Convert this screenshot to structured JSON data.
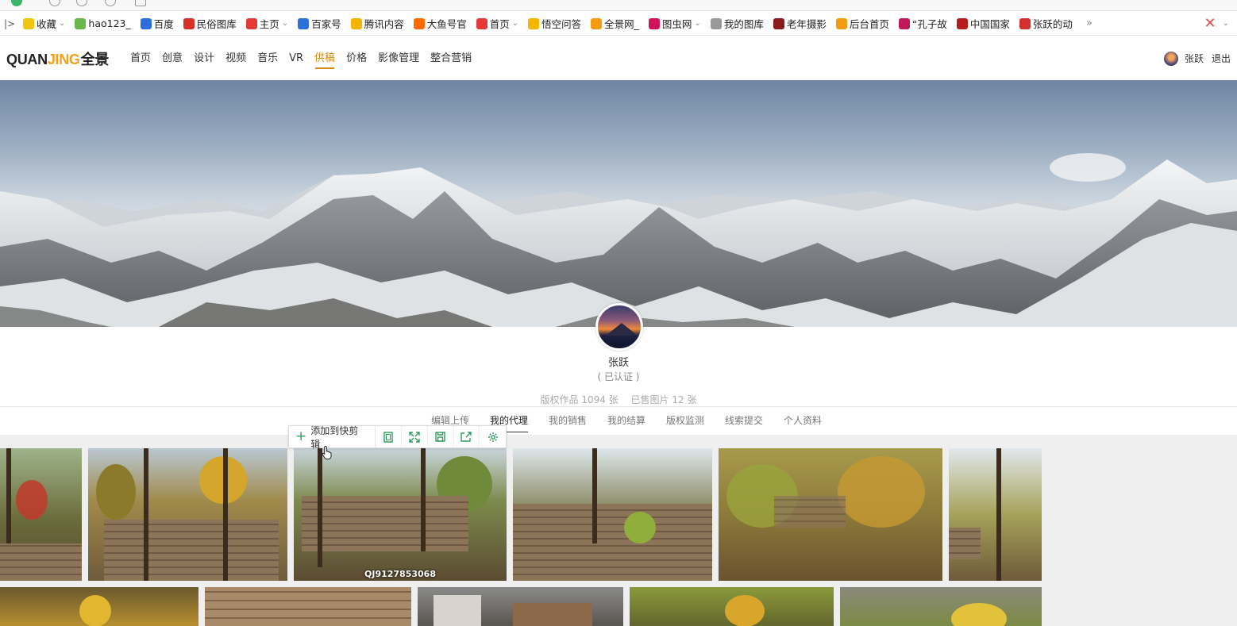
{
  "bookmarks": {
    "lead": "|>",
    "items": [
      {
        "label": "收藏",
        "color": "#f1c40f",
        "caret": true
      },
      {
        "label": "hao123_",
        "color": "#6bb84a",
        "caret": false
      },
      {
        "label": "百度",
        "color": "#2f6fdc",
        "caret": false
      },
      {
        "label": "民俗图库",
        "color": "#d93025",
        "caret": false
      },
      {
        "label": "主页",
        "color": "#e53935",
        "caret": true
      },
      {
        "label": "百家号",
        "color": "#2f6fdc",
        "caret": false
      },
      {
        "label": "腾讯内容",
        "color": "#f5b400",
        "caret": false
      },
      {
        "label": "大鱼号官",
        "color": "#ff6a00",
        "caret": false
      },
      {
        "label": "首页",
        "color": "#e53935",
        "caret": true
      },
      {
        "label": "悟空问答",
        "color": "#f5b400",
        "caret": false
      },
      {
        "label": "全景网_",
        "color": "#f39c12",
        "caret": false
      },
      {
        "label": "图虫网",
        "color": "#d4145a",
        "caret": true
      },
      {
        "label": "我的图库",
        "color": "#999999",
        "caret": false
      },
      {
        "label": "老年摄影",
        "color": "#8b1a1a",
        "caret": false
      },
      {
        "label": "后台首页",
        "color": "#f39c12",
        "caret": false
      },
      {
        "label": "“孔子故",
        "color": "#c2185b",
        "caret": false
      },
      {
        "label": "中国国家",
        "color": "#b71c1c",
        "caret": false
      },
      {
        "label": "张跃的动",
        "color": "#d32f2f",
        "caret": false
      }
    ],
    "more": "»"
  },
  "header": {
    "logo_q": "QUAN",
    "logo_j": "JING",
    "logo_cn": "全景",
    "nav": [
      "首页",
      "创意",
      "设计",
      "视频",
      "音乐",
      "VR",
      "供稿",
      "价格",
      "影像管理",
      "整合营销"
    ],
    "active_nav": "供稿",
    "user_name": "张跃",
    "logout": "退出"
  },
  "profile": {
    "name": "张跃",
    "verified": "( 已认证 )",
    "stat_works": "版权作品 1094 张",
    "stat_sold": "已售图片 12 张"
  },
  "tabs": [
    "编辑上传",
    "我的代理",
    "我的销售",
    "我的结算",
    "版权监测",
    "线索提交",
    "个人资料"
  ],
  "active_tab": "我的代理",
  "hover_toolbar": {
    "add_label": "添加到快剪辑"
  },
  "photo_caption": "QJ9127853068",
  "colors": {
    "accent_gold": "#d68b14",
    "logo_orange": "#f5a21a",
    "action_green": "#2a9d5c"
  }
}
